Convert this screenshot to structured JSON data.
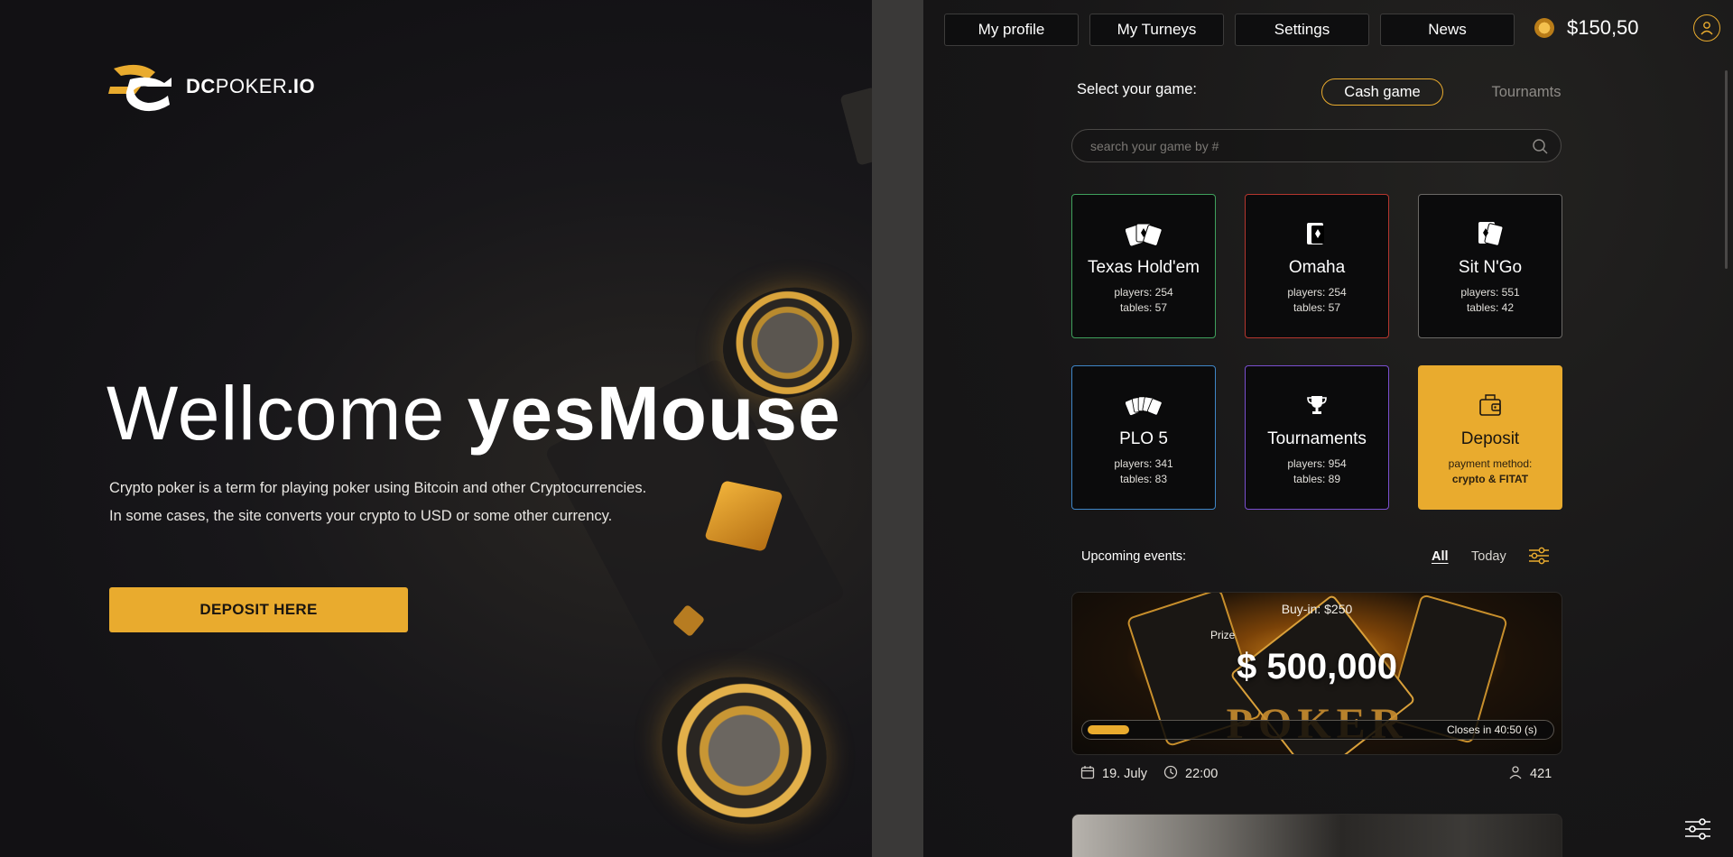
{
  "brand": {
    "logo_bold": "DC",
    "logo_regular": "POKER",
    "logo_suffix": ".IO"
  },
  "hero": {
    "welcome_prefix": "Wellcome",
    "username": "yesMouse",
    "desc_line1": "Crypto poker is a term for playing poker using Bitcoin and other Cryptocurrencies.",
    "desc_line2": "In some cases, the site converts your crypto to USD or some other currency.",
    "deposit_button": "DEPOSIT HERE"
  },
  "nav": {
    "items": [
      {
        "label": "My profile"
      },
      {
        "label": "My Turneys"
      },
      {
        "label": "Settings"
      },
      {
        "label": "News"
      }
    ],
    "balance": "$150,50"
  },
  "game_select": {
    "label": "Select your game:",
    "tabs": [
      {
        "label": "Cash game",
        "active": true
      },
      {
        "label": "Tournamts",
        "active": false
      }
    ],
    "search_placeholder": "search your game by #"
  },
  "games": [
    {
      "name": "Texas Hold'em",
      "players": "players: 254",
      "tables": "tables: 57",
      "icon": "cards-fan-icon",
      "border": "#3fa05c"
    },
    {
      "name": "Omaha",
      "players": "players: 254",
      "tables": "tables: 57",
      "icon": "cards-pair-icon",
      "border": "#b5362e"
    },
    {
      "name": "Sit N'Go",
      "players": "players: 551",
      "tables": "tables: 42",
      "icon": "cards-diamond-icon",
      "border": "#6b6966"
    },
    {
      "name": "PLO 5",
      "players": "players: 341",
      "tables": "tables: 83",
      "icon": "cards-five-icon",
      "border": "#3f86c8"
    },
    {
      "name": "Tournaments",
      "players": "players: 954",
      "tables": "tables: 89",
      "icon": "trophy-icon",
      "border": "#7a4fd0"
    }
  ],
  "deposit_card": {
    "name": "Deposit",
    "line1": "payment method:",
    "line2": "crypto & FITAT",
    "icon": "wallet-icon"
  },
  "events": {
    "label": "Upcoming events:",
    "filters": [
      {
        "label": "All",
        "active": true
      },
      {
        "label": "Today",
        "active": false
      }
    ],
    "first": {
      "buyin": "Buy-in: $250",
      "prize_label": "Prize",
      "prize": "$ 500,000",
      "banner_word": "POKER",
      "closes": "Closes in 40:50 (s)",
      "progress": 0.09,
      "date": "19. July",
      "time": "22:00",
      "players": "421"
    }
  },
  "colors": {
    "accent": "#e9ab2e",
    "panel_bg": "#171617",
    "hero_bg": "#121114"
  }
}
